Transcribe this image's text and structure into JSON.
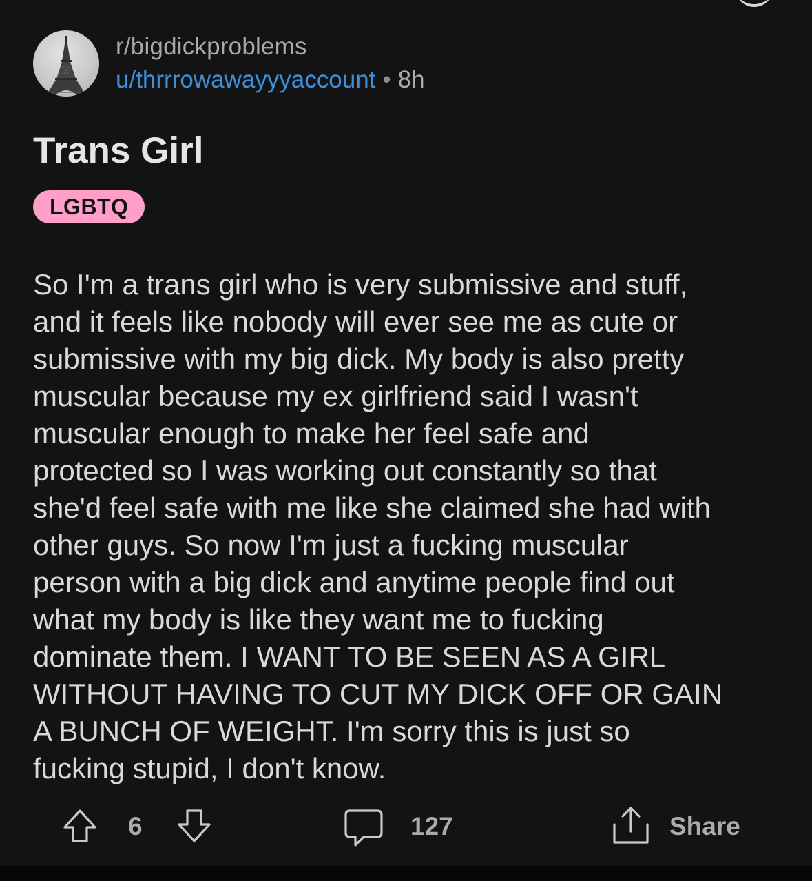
{
  "post": {
    "subreddit": "r/bigdickproblems",
    "username": "u/thrrrowawayyyaccount",
    "separator": "•",
    "age": "8h",
    "title": "Trans Girl",
    "flair": "LGBTQ",
    "flair_color": "#ff9ec9",
    "body": "So I'm a trans girl who is very submissive and stuff,\nand it feels like nobody will ever see me as cute or\nsubmissive with my big dick. My body is also pretty\nmuscular because my ex girlfriend said I wasn't\nmuscular enough to make her feel safe and\nprotected so I was working out constantly so that\nshe'd feel safe with me like she claimed she had with\nother guys. So now I'm just a fucking muscular\nperson with a big dick and anytime people find out\nwhat my body is like they want me to fucking\ndominate them. I WANT TO BE SEEN AS A GIRL\nWITHOUT HAVING TO CUT MY DICK OFF OR GAIN\nA BUNCH OF WEIGHT. I'm sorry this is just so\nfucking stupid, I don't know."
  },
  "actions": {
    "score": "6",
    "comments": "127",
    "share_label": "Share",
    "upvote_icon": "arrow-up-icon",
    "downvote_icon": "arrow-down-icon",
    "comment_icon": "speech-bubble-icon",
    "share_icon": "share-icon"
  },
  "theme": {
    "background": "#131313",
    "username_color": "#3e8ed8",
    "text_color": "#d7dadc",
    "muted_color": "#a9acae"
  }
}
